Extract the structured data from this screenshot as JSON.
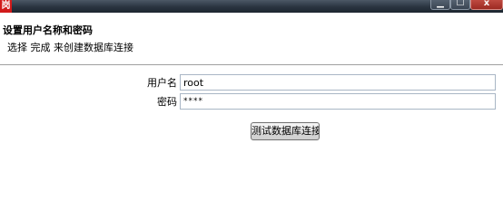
{
  "window": {
    "app_icon_glyph": "岗",
    "app_icon_color": "#d11a1a",
    "titlebar_color": "#2a3440",
    "minimize_glyph": "▁",
    "maximize_glyph": "☐",
    "close_glyph": "x"
  },
  "header": {
    "title": "设置用户名称和密码",
    "description": "选择 完成 来创建数据库连接"
  },
  "form": {
    "username": {
      "label": "用户名",
      "value": "root"
    },
    "password": {
      "label": "密码",
      "value": "****"
    },
    "test_button_label": "测试数据库连接"
  }
}
